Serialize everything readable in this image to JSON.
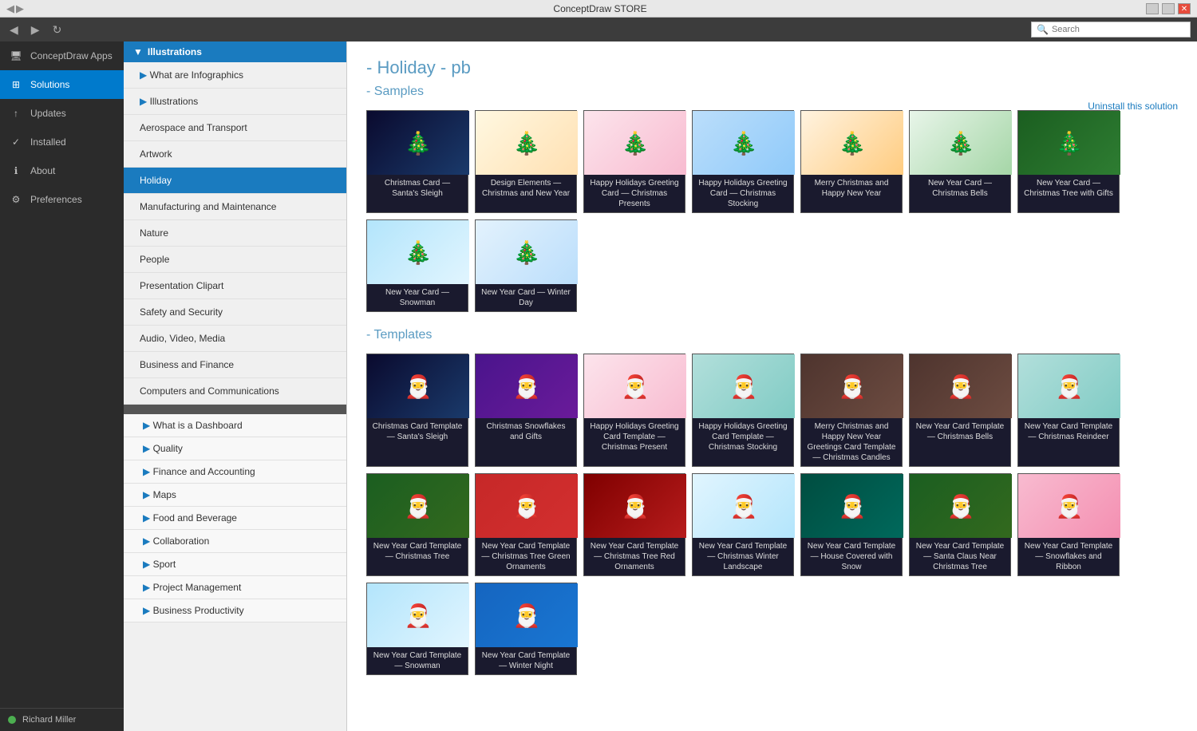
{
  "titleBar": {
    "title": "ConceptDraw STORE",
    "minBtn": "−",
    "restoreBtn": "□",
    "closeBtn": "✕"
  },
  "nav": {
    "backBtn": "◀",
    "forwardBtn": "▶",
    "refreshBtn": "↻",
    "searchPlaceholder": "Search"
  },
  "sidebar": {
    "items": [
      {
        "id": "conceptdraw-apps",
        "label": "ConceptDraw Apps",
        "icon": "🖥"
      },
      {
        "id": "solutions",
        "label": "Solutions",
        "icon": "⊞",
        "active": true
      },
      {
        "id": "updates",
        "label": "Updates",
        "icon": "↑"
      },
      {
        "id": "installed",
        "label": "Installed",
        "icon": "✓"
      },
      {
        "id": "about",
        "label": "About",
        "icon": "ℹ"
      },
      {
        "id": "preferences",
        "label": "Preferences",
        "icon": "⚙"
      }
    ],
    "user": {
      "name": "Richard Miller",
      "avatarColor": "#4caf50"
    }
  },
  "middlePanel": {
    "topSection": {
      "header": "Illustrations",
      "items": [
        "What are Infographics",
        "Illustrations"
      ]
    },
    "illustrationsItems": [
      "Aerospace and Transport",
      "Artwork",
      "Holiday",
      "Manufacturing and Maintenance",
      "Nature",
      "People",
      "Presentation Clipart",
      "Safety and Security",
      "Audio, Video, Media",
      "Business and Finance",
      "Computers and Communications"
    ],
    "bottomSection": {
      "items": [
        "What is a Dashboard",
        "Quality",
        "Finance and Accounting",
        "Maps",
        "Food and Beverage",
        "Collaboration",
        "Sport",
        "Project Management",
        "Business Productivity"
      ]
    }
  },
  "content": {
    "title": "- Holiday - pb",
    "uninstallLink": "Uninstall this solution",
    "samplesHeader": "- Samples",
    "templatesHeader": "- Templates",
    "samples": [
      {
        "label": "Christmas Card — Santa's Sleigh",
        "thumbClass": "thumb-dark-blue"
      },
      {
        "label": "Design Elements — Christmas and New Year",
        "thumbClass": "thumb-colorful"
      },
      {
        "label": "Happy Holidays Greeting Card — Christmas Presents",
        "thumbClass": "thumb-pink"
      },
      {
        "label": "Happy Holidays Greeting Card — Christmas Stocking",
        "thumbClass": "thumb-blue"
      },
      {
        "label": "Merry Christmas and Happy New Year",
        "thumbClass": "thumb-orange"
      },
      {
        "label": "New Year Card — Christmas Bells",
        "thumbClass": "thumb-green"
      },
      {
        "label": "New Year Card — Christmas Tree with Gifts",
        "thumbClass": "thumb-dark-green"
      },
      {
        "label": "New Year Card — Snowman",
        "thumbClass": "thumb-snowman"
      },
      {
        "label": "New Year Card — Winter Day",
        "thumbClass": "thumb-light-blue"
      }
    ],
    "templates": [
      {
        "label": "Christmas Card Template — Santa's Sleigh",
        "thumbClass": "thumb-dark-blue"
      },
      {
        "label": "Christmas Snowflakes and Gifts",
        "thumbClass": "thumb-dark-purple"
      },
      {
        "label": "Happy Holidays Greeting Card Template — Christmas Present",
        "thumbClass": "thumb-pink"
      },
      {
        "label": "Happy Holidays Greeting Card Template — Christmas Stocking",
        "thumbClass": "thumb-teal"
      },
      {
        "label": "Merry Christmas and Happy New Year Greetings Card Template — Christmas Candles",
        "thumbClass": "thumb-brown"
      },
      {
        "label": "New Year Card Template — Christmas Bells",
        "thumbClass": "thumb-brown"
      },
      {
        "label": "New Year Card Template — Christmas Reindeer",
        "thumbClass": "thumb-teal"
      },
      {
        "label": "New Year Card Template — Christmas Tree",
        "thumbClass": "thumb-forest"
      },
      {
        "label": "New Year Card Template — Christmas Tree Green Ornaments",
        "thumbClass": "thumb-red"
      },
      {
        "label": "New Year Card Template — Christmas Tree Red Ornaments",
        "thumbClass": "thumb-dark-red"
      },
      {
        "label": "New Year Card Template — Christmas Winter Landscape",
        "thumbClass": "thumb-snow-blue"
      },
      {
        "label": "New Year Card Template — House Covered with Snow",
        "thumbClass": "thumb-dark-teal"
      },
      {
        "label": "New Year Card Template — Santa Claus Near Christmas Tree",
        "thumbClass": "thumb-forest"
      },
      {
        "label": "New Year Card Template — Snowflakes and Ribbon",
        "thumbClass": "thumb-pink-bright"
      },
      {
        "label": "New Year Card Template — Snowman",
        "thumbClass": "thumb-snowman"
      },
      {
        "label": "New Year Card Template — Winter Night",
        "thumbClass": "thumb-bright-blue"
      }
    ]
  }
}
